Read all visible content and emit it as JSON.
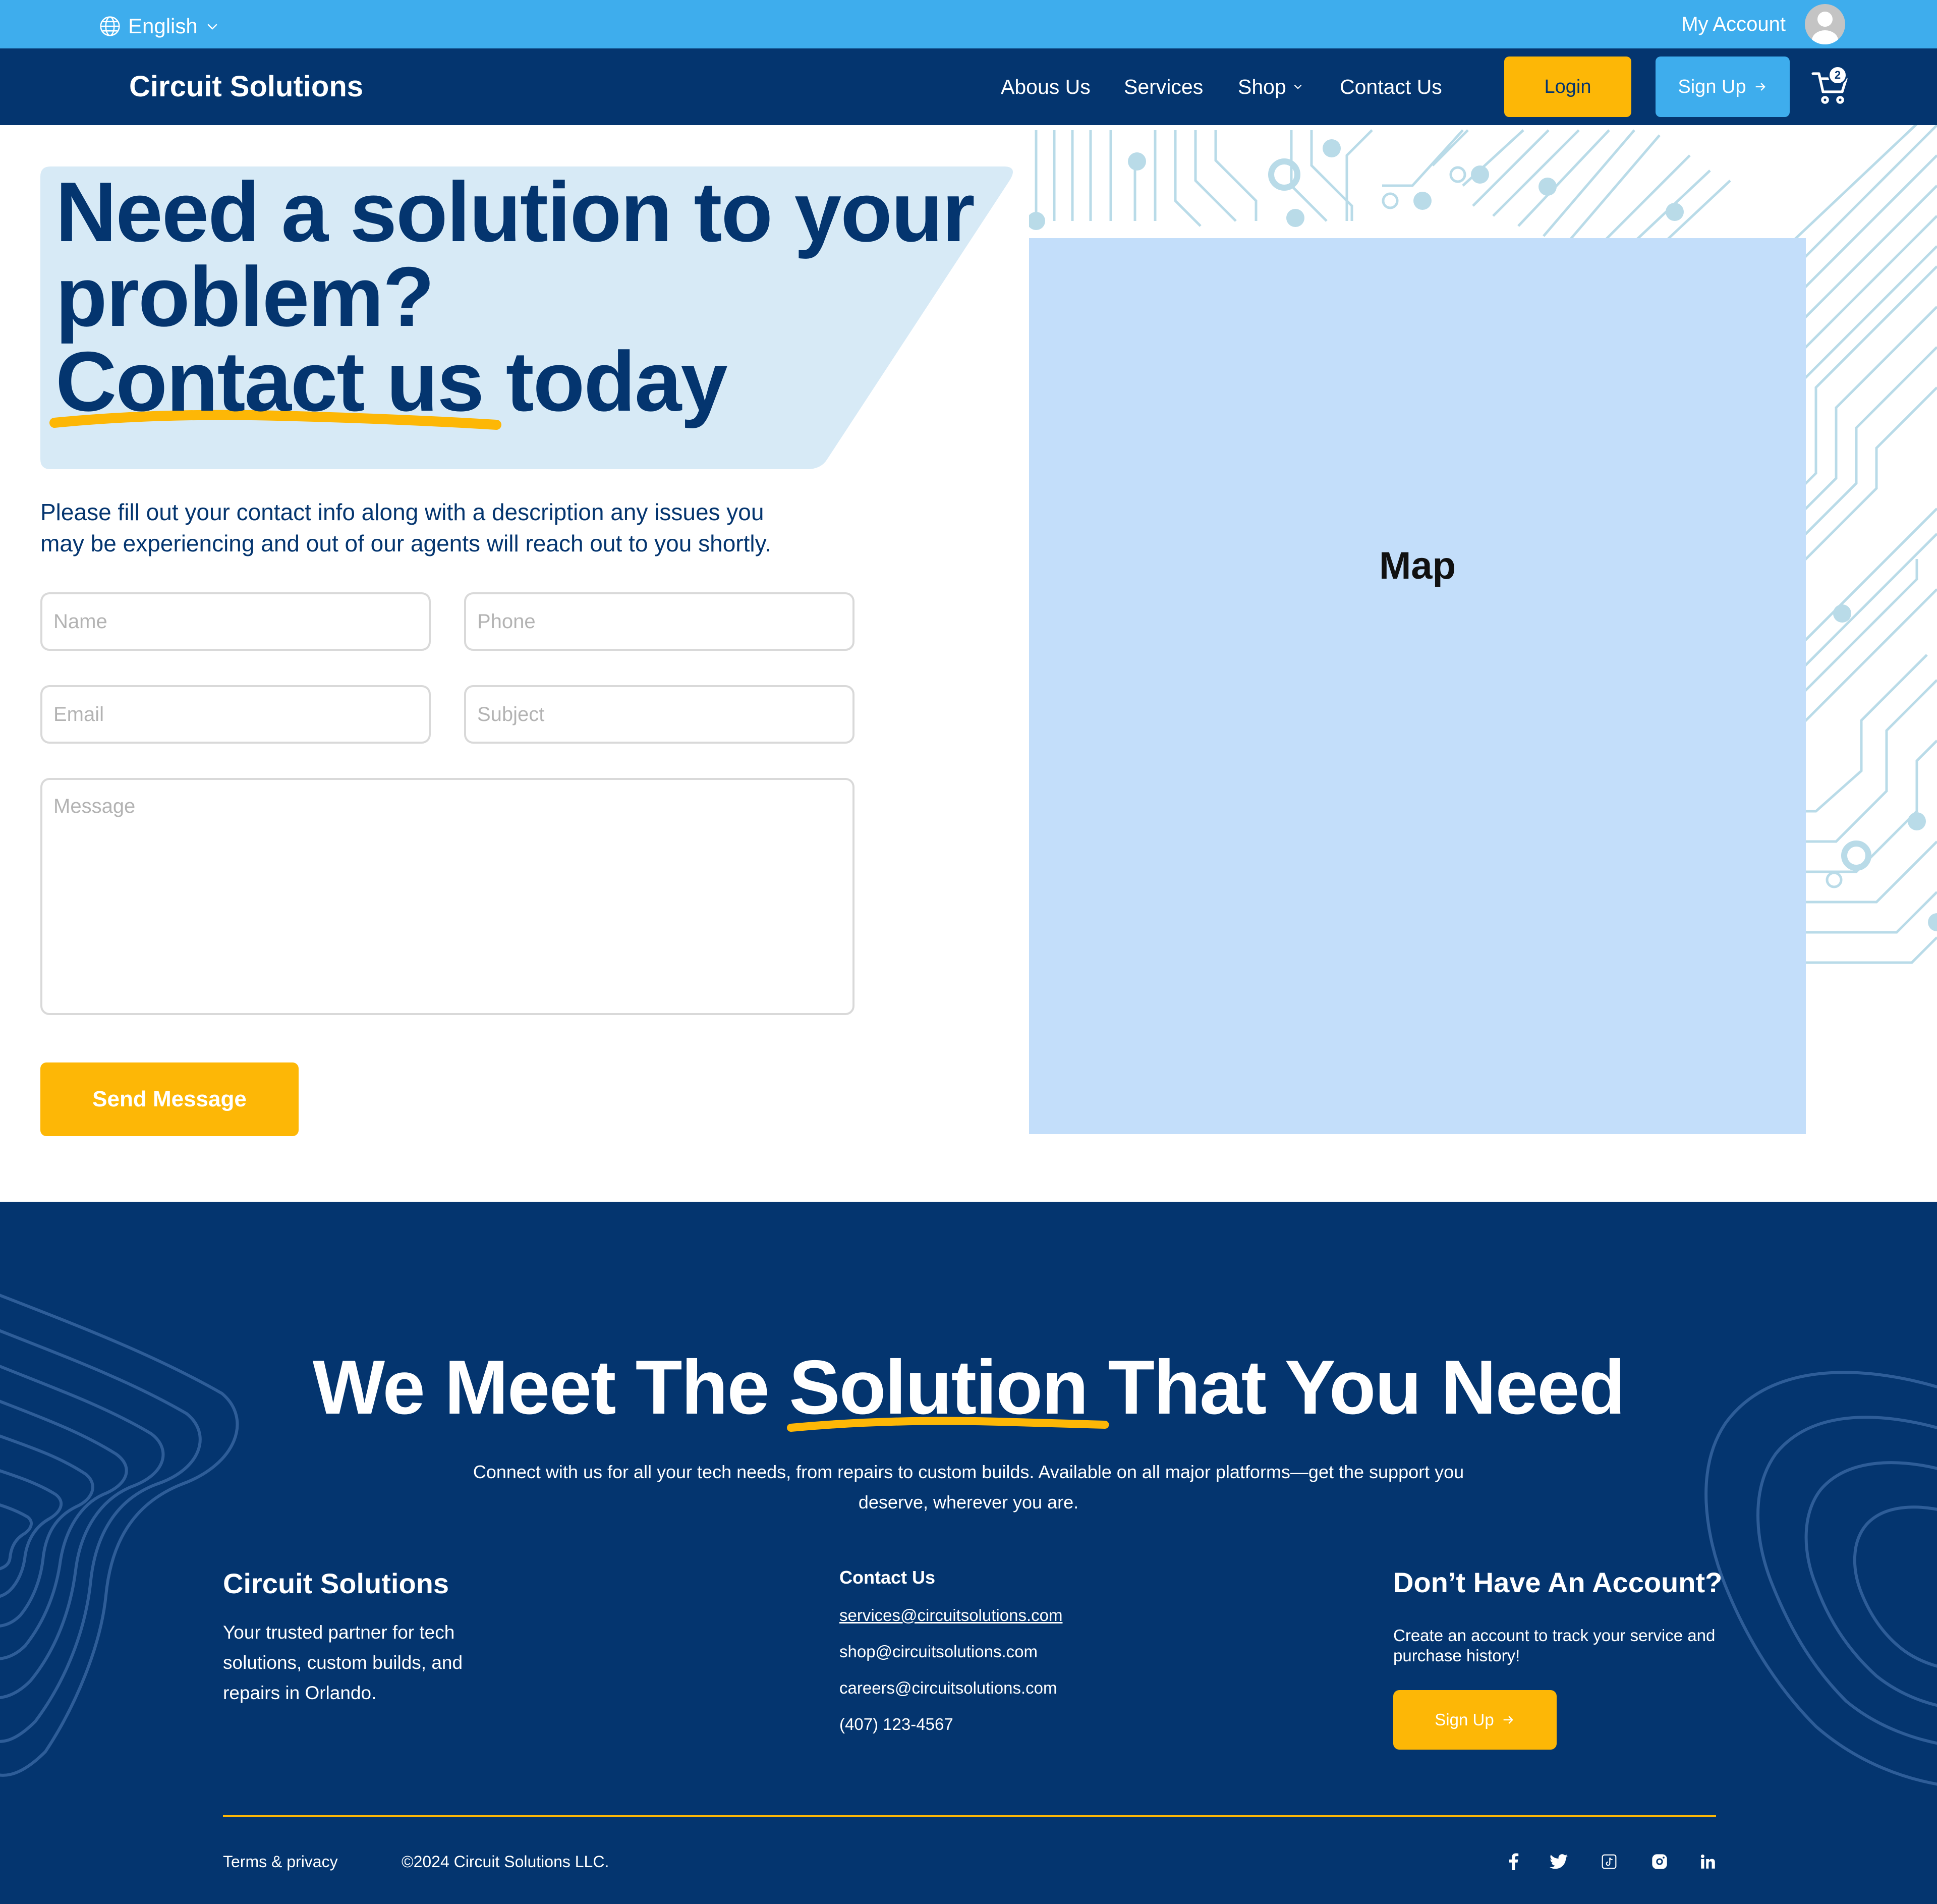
{
  "topbar": {
    "language": "English",
    "account_label": "My Account"
  },
  "nav": {
    "brand": "Circuit Solutions",
    "links": [
      "Abous Us",
      "Services",
      "Shop",
      "Contact Us"
    ],
    "login": "Login",
    "signup": "Sign Up",
    "cart_count": "2"
  },
  "hero": {
    "headline_line1": "Need a solution to your",
    "headline_line2": "problem?",
    "headline_line3a": "Contact us",
    "headline_line3b": " today",
    "intro_line1": "Please fill out your contact info along with a description any issues you",
    "intro_line2": "may be experiencing and out of our agents will reach out to you shortly."
  },
  "form": {
    "name_placeholder": "Name",
    "phone_placeholder": "Phone",
    "email_placeholder": "Email",
    "subject_placeholder": "Subject",
    "message_placeholder": "Message",
    "send_label": "Send Message"
  },
  "map": {
    "label": "Map"
  },
  "footer": {
    "title_a": "We Meet The ",
    "title_b": "Solution",
    "title_c": " That You Need",
    "sub_line1": "Connect with us for all your tech needs, from repairs to custom builds. Available on all major platforms—get the support you",
    "sub_line2": "deserve, wherever you are.",
    "brand": "Circuit Solutions",
    "tag_line1": "Your trusted partner for tech",
    "tag_line2": "solutions, custom builds, and",
    "tag_line3": "repairs in Orlando.",
    "contact_heading": "Contact Us",
    "email_services": "services@circuitsolutions.com",
    "email_shop": "shop@circuitsolutions.com",
    "email_careers": "careers@circuitsolutions.com",
    "phone": "(407) 123-4567",
    "account_heading": "Don’t Have An Account?",
    "account_text": "Create an account to track your service and purchase history!",
    "signup": "Sign Up",
    "terms": "Terms & privacy",
    "copyright": "©2024 Circuit Solutions LLC.",
    "social_icons": [
      "facebook-icon",
      "twitter-icon",
      "tiktok-icon",
      "instagram-icon",
      "linkedin-icon"
    ]
  },
  "colors": {
    "navy": "#04356f",
    "sky": "#3eaded",
    "yellow": "#fdb706",
    "map_fill": "#c3defa",
    "hero_panel": "#d7eaf6"
  }
}
